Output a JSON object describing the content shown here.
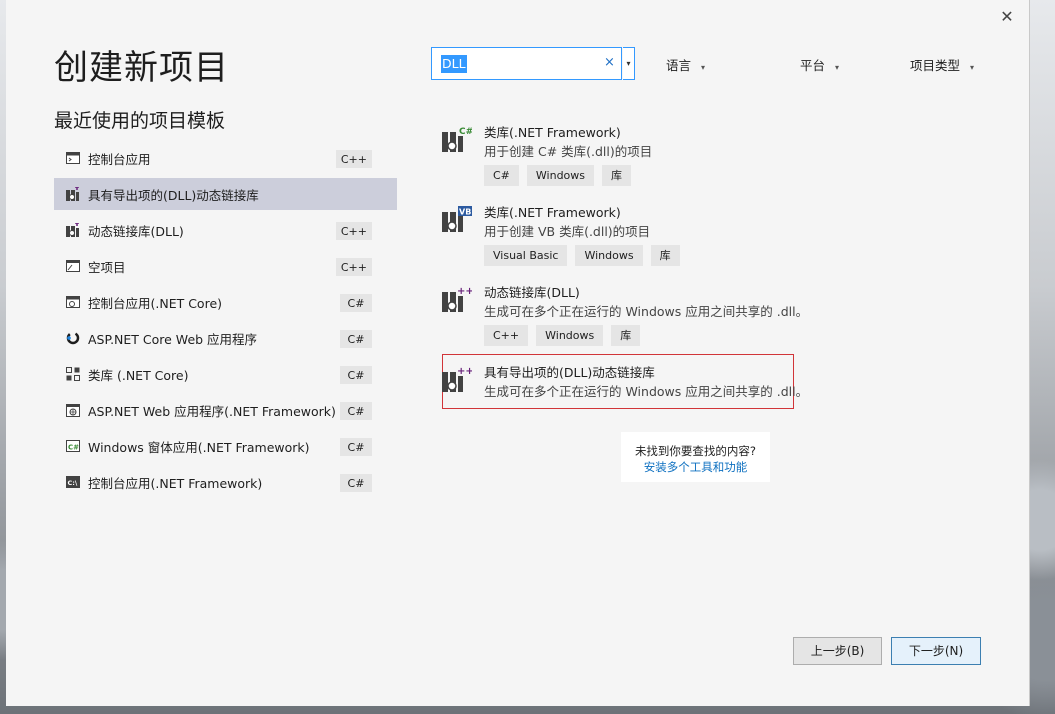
{
  "dialog": {
    "title": "创建新项目",
    "close_label": "✕"
  },
  "recent": {
    "title": "最近使用的项目模板",
    "items": [
      {
        "label": "控制台应用",
        "lang": "C++",
        "icon": "console-icon"
      },
      {
        "label": "具有导出项的(DLL)动态链接库",
        "lang": "",
        "icon": "dll-export-icon"
      },
      {
        "label": "动态链接库(DLL)",
        "lang": "C++",
        "icon": "dll-icon"
      },
      {
        "label": "空项目",
        "lang": "C++",
        "icon": "empty-project-icon"
      },
      {
        "label": "控制台应用(.NET Core)",
        "lang": "C#",
        "icon": "console-core-icon"
      },
      {
        "label": "ASP.NET Core Web 应用程序",
        "lang": "C#",
        "icon": "aspnet-core-icon"
      },
      {
        "label": "类库 (.NET Core)",
        "lang": "C#",
        "icon": "class-library-icon"
      },
      {
        "label": "ASP.NET Web 应用程序(.NET Framework)",
        "lang": "C#",
        "icon": "aspnet-icon"
      },
      {
        "label": "Windows 窗体应用(.NET Framework)",
        "lang": "C#",
        "icon": "winforms-icon"
      },
      {
        "label": "控制台应用(.NET Framework)",
        "lang": "C#",
        "icon": "console-framework-icon"
      }
    ]
  },
  "search": {
    "value": "DLL",
    "clear": "×",
    "dropdown": "▾"
  },
  "filters": {
    "language": "语言",
    "platform": "平台",
    "project_type": "项目类型",
    "chevron": "▾"
  },
  "results": [
    {
      "title": "类库(.NET Framework)",
      "desc": "用于创建 C# 类库(.dll)的项目",
      "badge": "C#",
      "tags": [
        "C#",
        "Windows",
        "库"
      ]
    },
    {
      "title": "类库(.NET Framework)",
      "desc": "用于创建 VB 类库(.dll)的项目",
      "badge": "VB",
      "tags": [
        "Visual Basic",
        "Windows",
        "库"
      ]
    },
    {
      "title": "动态链接库(DLL)",
      "desc": "生成可在多个正在运行的 Windows 应用之间共享的 .dll。",
      "badge": "++",
      "tags": [
        "C++",
        "Windows",
        "库"
      ]
    },
    {
      "title": "具有导出项的(DLL)动态链接库",
      "desc": "生成可在多个正在运行的 Windows 应用之间共享的 .dll。",
      "badge": "++",
      "tags": []
    }
  ],
  "not_found": {
    "question": "未找到你要查找的内容?",
    "link": "安装多个工具和功能"
  },
  "buttons": {
    "back": "上一步(B)",
    "next": "下一步(N)"
  },
  "colors": {
    "accent": "#3399ff",
    "selected_bg": "#cccedb",
    "highlight_border": "#d13438",
    "link": "#0e70c0",
    "csharp": "#388a34",
    "vb": "#2c5aa0",
    "cpp": "#68217a"
  }
}
